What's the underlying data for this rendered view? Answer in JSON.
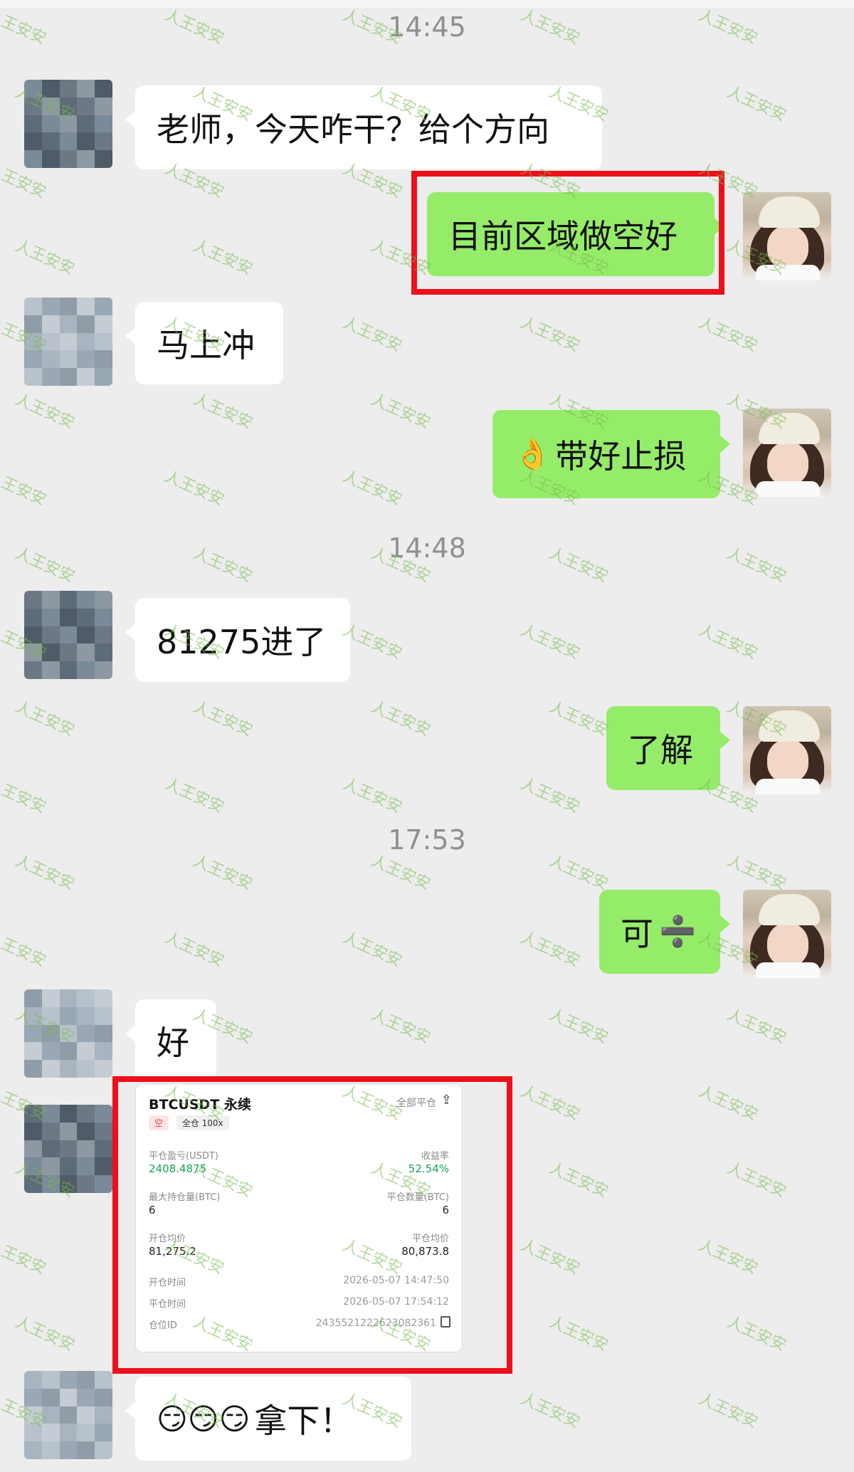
{
  "timestamps": [
    "14:45",
    "14:48",
    "17:53"
  ],
  "messages": {
    "m1": "老师，今天咋干？给个方向",
    "m2": "目前区域做空好",
    "m3": "马上冲",
    "m4_emoji": "👌",
    "m4": "带好止损",
    "m5": "81275进了",
    "m6": "了解",
    "m7": "可",
    "m7_symbol": "➗",
    "m8": "好",
    "m9_emojis": "😏😏😏",
    "m9": "拿下！"
  },
  "watermark": "人王安安",
  "card": {
    "title": "BTCUSDT 永续",
    "close_all": "全部平仓",
    "tag_short": "空",
    "tag_margin": "全仓 100x",
    "pnl_label": "平仓盈亏(USDT)",
    "pnl_value": "2408.4875",
    "roi_label": "收益率",
    "roi_value": "52.54%",
    "max_pos_label": "最大持仓量(BTC)",
    "max_pos_value": "6",
    "close_qty_label": "平仓数量(BTC)",
    "close_qty_value": "6",
    "open_avg_label": "开仓均价",
    "open_avg_value": "81,275.2",
    "close_avg_label": "平仓均价",
    "close_avg_value": "80,873.8",
    "open_time_label": "开仓时间",
    "open_time_value": "2026-05-07 14:47:50",
    "close_time_label": "平仓时间",
    "close_time_value": "2026-05-07 17:54:12",
    "pos_id_label": "仓位ID",
    "pos_id_value": "2435521222623082361"
  },
  "colors": {
    "background": "#ededed",
    "incoming_bubble": "#ffffff",
    "outgoing_bubble": "#95ec69",
    "highlight_box": "#ee0f1a",
    "profit_green": "#1aa260"
  }
}
